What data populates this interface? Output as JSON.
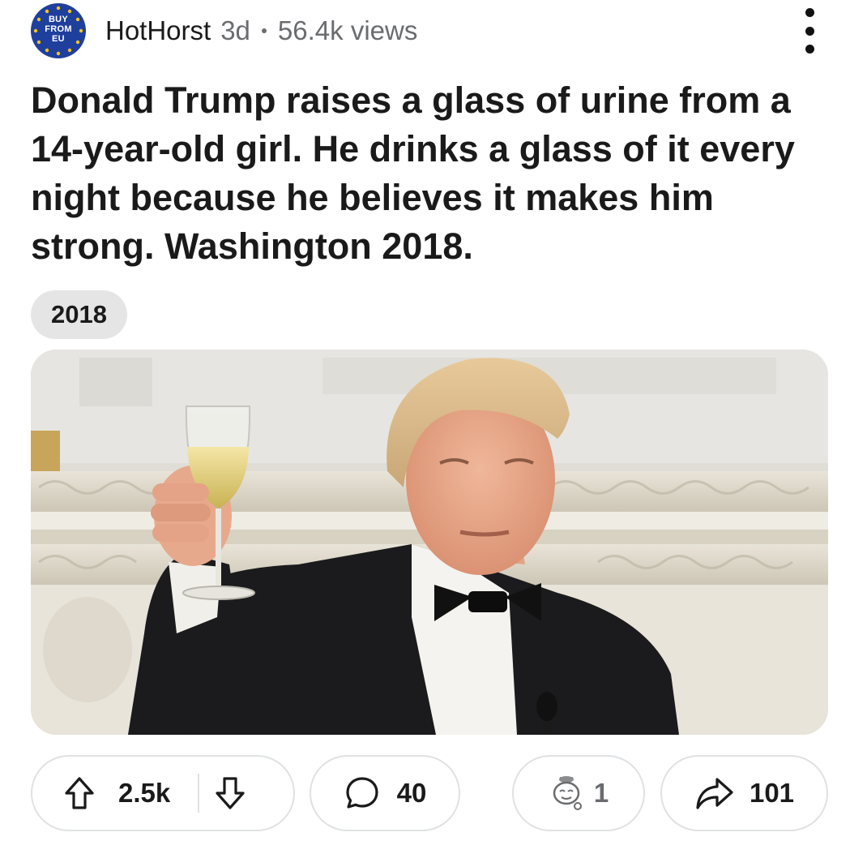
{
  "post": {
    "author": {
      "name": "HotHorst",
      "avatar_text": [
        "BUY",
        "FROM",
        "EU"
      ],
      "avatar_color": "#1f3f9c",
      "avatar_star_color": "#f5c518"
    },
    "age": "3d",
    "views": "56.4k views",
    "title": "Donald Trump raises a glass of urine from a 14-year-old girl. He drinks a glass of it every night because he believes it makes him strong. Washington 2018.",
    "flair": "2018",
    "image_icon": "photo"
  },
  "actions": {
    "upvote_icon": "arrow-up-icon",
    "downvote_icon": "arrow-down-icon",
    "score": "2.5k",
    "comment_icon": "speech-bubble-icon",
    "comments": "40",
    "award_icon": "award-icon",
    "awards": "1",
    "share_icon": "share-arrow-icon",
    "shares": "101"
  },
  "colors": {
    "text": "#1a1a1b",
    "muted": "#6a6c6f",
    "flair_bg": "#e5e5e6",
    "pill_border": "#dfe1e3"
  }
}
